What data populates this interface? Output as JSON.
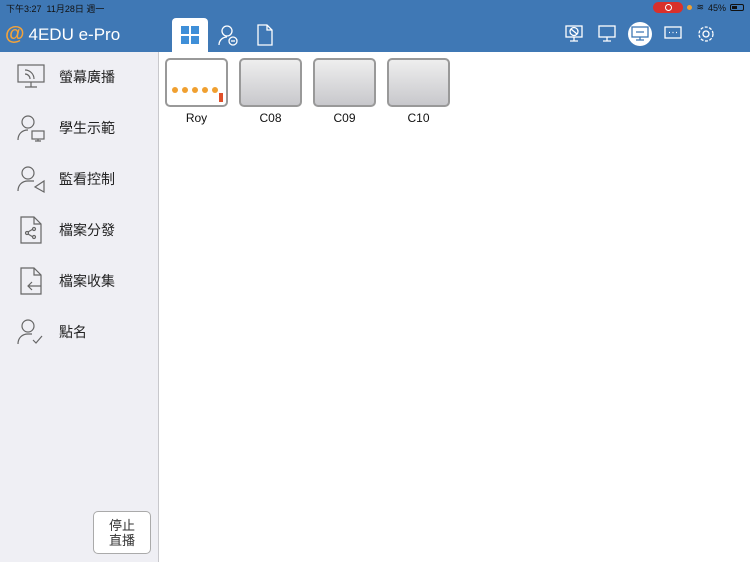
{
  "status": {
    "time": "下午3:27",
    "date": "11月28日 週一",
    "battery": "45%"
  },
  "app": {
    "title": "4EDU e-Pro"
  },
  "sidebar": {
    "items": [
      {
        "label": "螢幕廣播"
      },
      {
        "label": "學生示範"
      },
      {
        "label": "監看控制"
      },
      {
        "label": "檔案分發"
      },
      {
        "label": "檔案收集"
      },
      {
        "label": "點名"
      }
    ],
    "stop_line1": "停止",
    "stop_line2": "直播"
  },
  "students": [
    {
      "name": "Roy"
    },
    {
      "name": "C08"
    },
    {
      "name": "C09"
    },
    {
      "name": "C10"
    }
  ]
}
